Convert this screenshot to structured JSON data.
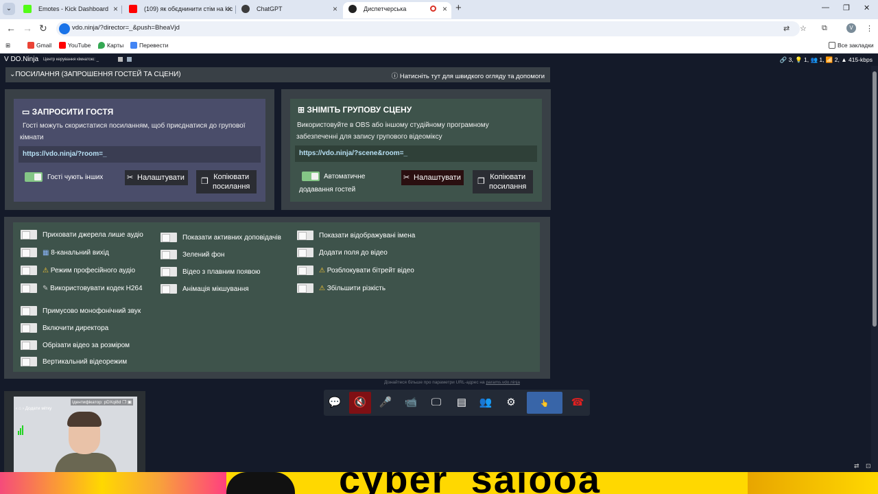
{
  "browser": {
    "tabs": [
      {
        "title": "Emotes - Kick Dashboard",
        "favicon_color": "#53fc18"
      },
      {
        "title": "(109) як обєднинити стім на kic",
        "favicon_color": "#ff0000"
      },
      {
        "title": "ChatGPT",
        "favicon_color": "#3c3c3c"
      },
      {
        "title": "Диспетчерська",
        "favicon_color": "#222222"
      }
    ],
    "address": "vdo.ninja/?director=_&push=BheaVjd",
    "profile_letter": "V",
    "bookmarks": [
      {
        "label": "Gmail",
        "color": "#ea4335"
      },
      {
        "label": "YouTube",
        "color": "#ff0000"
      },
      {
        "label": "Карты",
        "color": "#34a853"
      },
      {
        "label": "Перевести",
        "color": "#4285f4"
      }
    ],
    "all_bookmarks": "Все закладки"
  },
  "app": {
    "brand": "DO.Ninja",
    "brand_sub": "Центр керування кімнатою: _",
    "stats": "🔗 3,  💡 1,  👥 1,  📶 2,  ▲ 415-kbps",
    "links_header": "ПОСИЛАННЯ (ЗАПРОШЕННЯ ГОСТЕЙ ТА СЦЕНИ)",
    "help": "Натисніть тут для швидкого огляду та допомоги"
  },
  "invite": {
    "title": "ЗАПРОСИТИ ГОСТЯ",
    "desc_line1": "Гості можуть скористатися посиланням, щоб приєднатися до групової",
    "desc_line2": "кімнати",
    "link": "https://vdo.ninja/?room=_",
    "toggle_label": "Гості чують інших",
    "settings": "Налаштувати",
    "copy_line1": "Копіювати",
    "copy_line2": "посилання"
  },
  "scene": {
    "title": "ЗНІМІТЬ ГРУПОВУ СЦЕНУ",
    "desc_line1": "Використовуйте в OBS або іншому студійному програмному",
    "desc_line2": "забезпеченні для запису групового відеоміксу",
    "link": "https://vdo.ninja/?scene&room=_",
    "toggle_line1": "Автоматичне",
    "toggle_line2": "додавання гостей",
    "settings": "Налаштувати",
    "copy_line1": "Копіювати",
    "copy_line2": "посилання"
  },
  "options": {
    "col1": [
      "Приховати джерела лише аудіо",
      "8-канальний вихід",
      "Режим професійного аудіо",
      "Використовувати кодек H264",
      "Примусово монофонічний звук",
      "Включити директора",
      "Обрізати відео за розміром",
      "Вертикальний відеорежим"
    ],
    "col2": [
      "Показати активних доповідачів",
      "Зелений фон",
      "Відео з плавним появою",
      "Анімація мікшування"
    ],
    "col3": [
      "Показати відображувані імена",
      "Додати поля до відео",
      "Розблокувати бітрейт відео",
      "Збільшити різкість"
    ],
    "more_prefix": "Дізнайтеся більше про параметри URL-адрес на",
    "more_link": "params.vdo.ninja"
  },
  "preview": {
    "id_label": "Ідентифікатор: pDXqi8d",
    "tag": "Додати мітку"
  },
  "controls": [
    {
      "name": "chat-button",
      "icon": "💬"
    },
    {
      "name": "mute-speaker-button",
      "icon": "🔇"
    },
    {
      "name": "mic-button",
      "icon": "🎤"
    },
    {
      "name": "camera-button",
      "icon": "📹"
    },
    {
      "name": "screenshare-button",
      "icon": "🖵"
    },
    {
      "name": "whiteboard-button",
      "icon": "▤"
    },
    {
      "name": "participants-button",
      "icon": "👥"
    },
    {
      "name": "settings-button",
      "icon": "⚙"
    },
    {
      "name": "self-preview-button",
      "icon": ""
    },
    {
      "name": "hangup-button",
      "icon": "☎"
    }
  ],
  "overlay_text": "cyber_saiooa"
}
